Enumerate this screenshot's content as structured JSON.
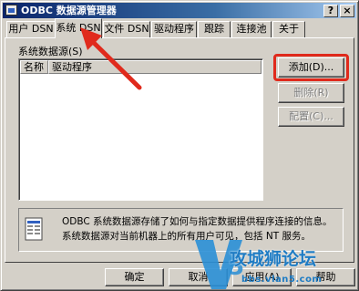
{
  "window": {
    "title": "ODBC 数据源管理器",
    "close_glyph": "×",
    "help_glyph": "?"
  },
  "tabs": [
    {
      "label": "用户 DSN",
      "active": false
    },
    {
      "label": "系统 DSN",
      "active": true
    },
    {
      "label": "文件 DSN",
      "active": false
    },
    {
      "label": "驱动程序",
      "active": false
    },
    {
      "label": "跟踪",
      "active": false
    },
    {
      "label": "连接池",
      "active": false
    },
    {
      "label": "关于",
      "active": false
    }
  ],
  "panel": {
    "group_label": "系统数据源(S)",
    "columns": [
      "名称",
      "驱动程序"
    ],
    "rows": []
  },
  "side_buttons": {
    "add": "添加(D)...",
    "remove": "删除(R)",
    "configure": "配置(C)..."
  },
  "info": {
    "icon": "data-source-icon",
    "text": "ODBC 系统数据源存储了如何与指定数据提供程序连接的信息。系统数据源对当前机器上的所有用户可见，包括 NT 服务。"
  },
  "footer_buttons": {
    "ok": "确定",
    "cancel": "取消",
    "apply": "应用(A)",
    "help": "帮助"
  },
  "annotations": {
    "highlight_color": "#e02a1c",
    "arrow_color": "#e02a1c"
  },
  "watermark": {
    "title": "攻城狮论坛",
    "url": "bbs.vlan5.com",
    "color": "#1f7cc4"
  }
}
